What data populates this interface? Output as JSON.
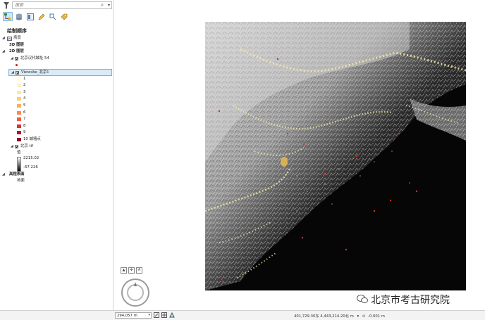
{
  "contents_pane": {
    "search_placeholder": "搜索",
    "title": "绘制顺序",
    "tree": {
      "scene": "场景",
      "layer_3d": "3D 图层",
      "layer_2d": "2D 图层",
      "points_layer": "北京汉代城址 54",
      "viewshed_layer": "Viewshe_北京1",
      "classes": [
        {
          "label": "1",
          "color": "#fffae0"
        },
        {
          "label": "2",
          "color": "#fff1c2"
        },
        {
          "label": "3",
          "color": "#fde6a4"
        },
        {
          "label": "4",
          "color": "#fdcc72"
        },
        {
          "label": "5",
          "color": "#fcae5c"
        },
        {
          "label": "6",
          "color": "#f88a4a"
        },
        {
          "label": "7",
          "color": "#ef5e3d"
        },
        {
          "label": "8",
          "color": "#dc3034"
        },
        {
          "label": "9",
          "color": "#b9122d"
        },
        {
          "label": "10 城墙点",
          "color": "#8c0529"
        }
      ],
      "dem_layer": "北京 tif",
      "value_heading": "值",
      "dem_high": "2215.02",
      "dem_low": "-67.226",
      "elevation": "高程表面",
      "ground": "地面"
    }
  },
  "status_bar": {
    "scale": "294,057 m",
    "coordinates": "401,729.30东 4,443,214.20北 m",
    "tilt": "-0.001 m"
  },
  "watermark": "北京市考古研究院",
  "colors": {
    "accent": "#86b9e0",
    "selection": "#d9ebf9",
    "point": "#d42a2a",
    "visible": "#f3e7a8"
  }
}
